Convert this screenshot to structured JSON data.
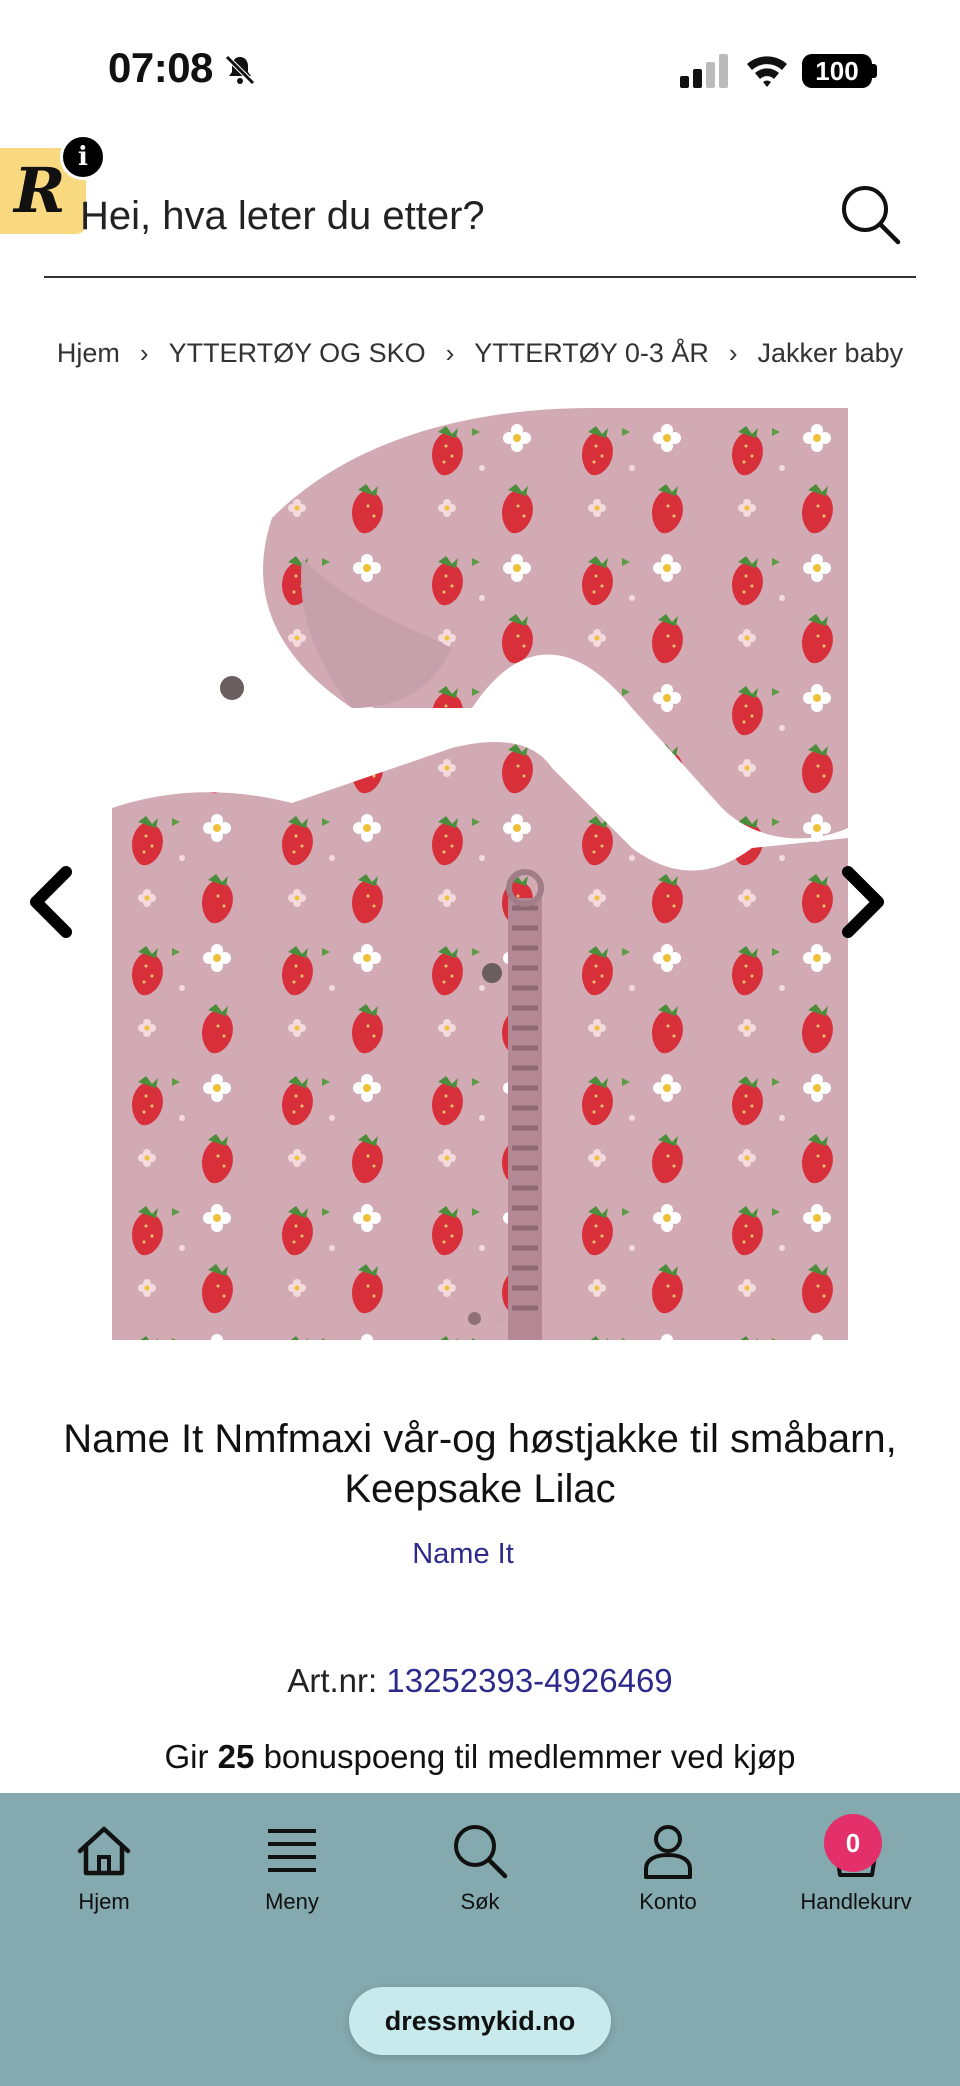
{
  "status_bar": {
    "time": "07:08",
    "battery": "100"
  },
  "search": {
    "placeholder": "Hei, hva leter du etter?"
  },
  "breadcrumb": [
    "Hjem",
    "YTTERTØY OG SKO",
    "YTTERTØY 0-3 ÅR",
    "Jakker baby"
  ],
  "breadcrumb_separator": "›",
  "product": {
    "title": "Name It Nmfmaxi vår-og høstjakke til småbarn, Keepsake Lilac",
    "brand": "Name It",
    "art_label": "Art.nr:",
    "art_number": "13252393-4926469",
    "bonus_prefix": "Gir",
    "bonus_points": "25",
    "bonus_suffix": "bonuspoeng til medlemmer ved kjøp",
    "image_count": 2,
    "active_image": 1
  },
  "logo": {
    "letter": "R",
    "info": "i"
  },
  "bottom_nav": {
    "items": [
      {
        "label": "Hjem",
        "icon": "home-icon"
      },
      {
        "label": "Meny",
        "icon": "menu-icon"
      },
      {
        "label": "Søk",
        "icon": "search-icon"
      },
      {
        "label": "Konto",
        "icon": "user-icon"
      },
      {
        "label": "Handlekurv",
        "icon": "cart-icon"
      }
    ],
    "cart_count": "0"
  },
  "browser": {
    "url": "dressmykid.no"
  },
  "colors": {
    "nav_bg": "#84a9ae",
    "badge": "#e3306a",
    "brand_link": "#2e2a8c",
    "logo_bg": "#f9d980"
  }
}
